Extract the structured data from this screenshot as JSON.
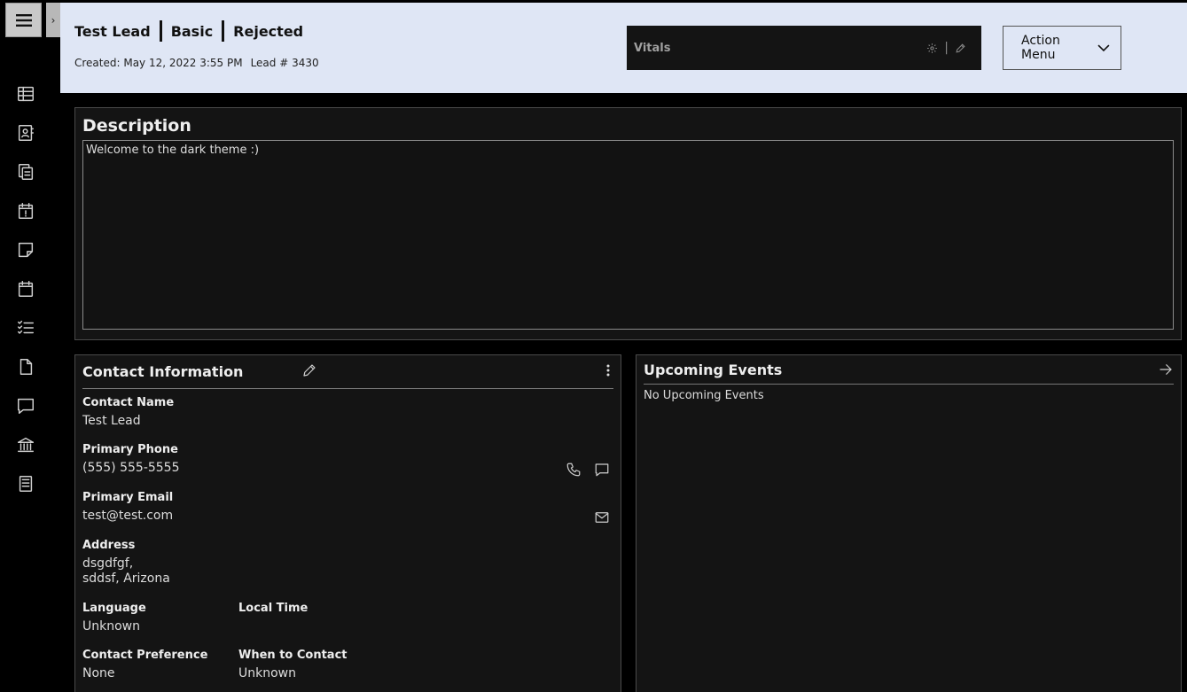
{
  "header": {
    "lead_name": "Test Lead",
    "lead_type": "Basic",
    "status": "Rejected",
    "created": "Created: May 12, 2022 3:55 PM",
    "lead_number": "Lead # 3430",
    "vitals_label": "Vitals",
    "vitals_sep": "|",
    "action_menu_label": "Action Menu"
  },
  "sidebar": {
    "icons": [
      "table-icon",
      "contact-card-icon",
      "copy-icon",
      "calendar-alert-icon",
      "note-icon",
      "calendar-icon",
      "checklist-icon",
      "file-icon",
      "chat-icon",
      "bank-icon",
      "book-icon"
    ]
  },
  "description": {
    "title": "Description",
    "text": "Welcome to the dark theme :)"
  },
  "contact": {
    "title": "Contact Information",
    "name_label": "Contact Name",
    "name_value": "Test Lead",
    "phone_label": "Primary Phone",
    "phone_value": "(555) 555-5555",
    "email_label": "Primary Email",
    "email_value": "test@test.com",
    "address_label": "Address",
    "address_line1": "dsgdfgf,",
    "address_line2": "sddsf, Arizona",
    "language_label": "Language",
    "language_value": "Unknown",
    "local_time_label": "Local Time",
    "local_time_value": "",
    "preference_label": "Contact Preference",
    "preference_value": "None",
    "when_label": "When to Contact",
    "when_value": "Unknown"
  },
  "events": {
    "title": "Upcoming Events",
    "empty_text": "No Upcoming Events"
  },
  "colors": {
    "header_bg": "#dfe6f5",
    "panel_bg": "#141414",
    "page_bg": "#000000"
  }
}
